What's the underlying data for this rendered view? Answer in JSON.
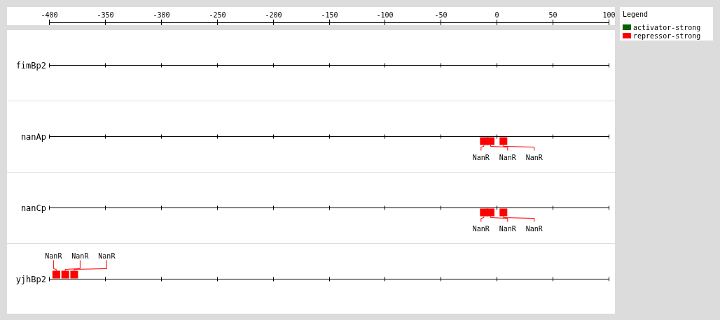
{
  "chart_data": {
    "type": "scatter",
    "orientation": "horizontal",
    "xlim": [
      -400,
      100
    ],
    "xticks": [
      -400,
      -350,
      -300,
      -250,
      -200,
      -150,
      -100,
      -50,
      0,
      50,
      100
    ],
    "categories": [
      "fimBp2",
      "nanAp",
      "nanCp",
      "yjhBp2"
    ],
    "grid": true,
    "series": [
      {
        "color": "#ff0000",
        "values": [
          null,
          -11.5,
          -11.5,
          -393.5
        ],
        "value_labels": [
          null,
          "NanR",
          "NanR",
          "NanR"
        ]
      },
      {
        "color": "#ff0000",
        "values": [
          null,
          -5.5,
          -5.5,
          -385.5
        ],
        "value_labels": [
          null,
          "NanR",
          "NanR",
          "NanR"
        ]
      },
      {
        "color": "#ff0000",
        "values": [
          null,
          6,
          6,
          -377.5
        ],
        "value_labels": [
          null,
          "NanR",
          "NanR",
          "NanR"
        ]
      }
    ]
  },
  "legend": {
    "title": "Legend",
    "items": [
      {
        "label": "activator-strong",
        "color": "#006400"
      },
      {
        "label": "repressor-strong",
        "color": "#ff0000"
      }
    ]
  }
}
